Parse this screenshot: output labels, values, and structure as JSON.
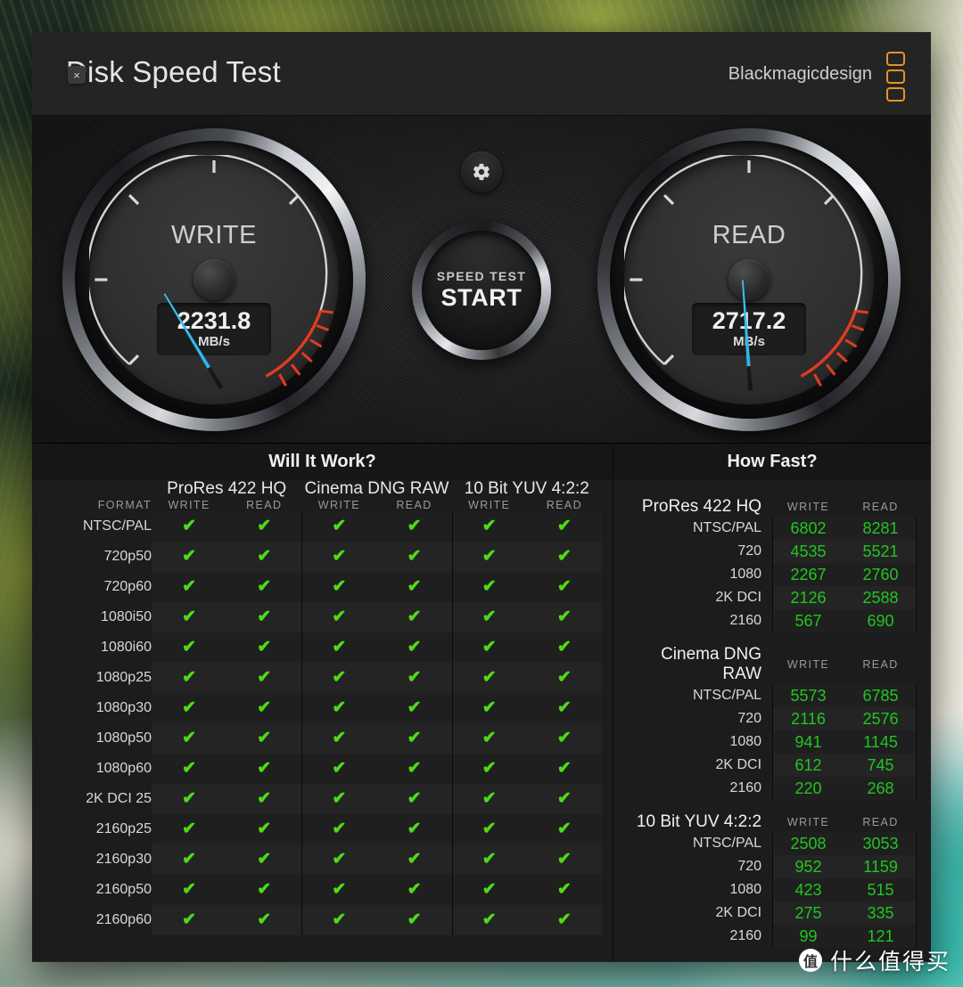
{
  "window": {
    "close_label": "×",
    "title": "Disk Speed Test",
    "brand": "Blackmagicdesign"
  },
  "gauges": {
    "write": {
      "label": "WRITE",
      "value": "2231.8",
      "unit": "MB/s",
      "needle_deg": -31
    },
    "read": {
      "label": "READ",
      "value": "2717.2",
      "unit": "MB/s",
      "needle_deg": -4
    }
  },
  "center": {
    "gear_icon": "gear-icon",
    "start_sub": "SPEED TEST",
    "start_main": "START"
  },
  "will_it_work": {
    "title": "Will It Work?",
    "format_header": "FORMAT",
    "groups": [
      "ProRes 422 HQ",
      "Cinema DNG RAW",
      "10 Bit YUV 4:2:2"
    ],
    "sub_headers": [
      "WRITE",
      "READ"
    ],
    "formats": [
      "NTSC/PAL",
      "720p50",
      "720p60",
      "1080i50",
      "1080i60",
      "1080p25",
      "1080p30",
      "1080p50",
      "1080p60",
      "2K DCI 25",
      "2160p25",
      "2160p30",
      "2160p50",
      "2160p60"
    ],
    "check_glyph": "✔",
    "check_color": "#4ddb19",
    "rows": [
      {
        "format": "NTSC/PAL",
        "cells": [
          true,
          true,
          true,
          true,
          true,
          true
        ]
      },
      {
        "format": "720p50",
        "cells": [
          true,
          true,
          true,
          true,
          true,
          true
        ]
      },
      {
        "format": "720p60",
        "cells": [
          true,
          true,
          true,
          true,
          true,
          true
        ]
      },
      {
        "format": "1080i50",
        "cells": [
          true,
          true,
          true,
          true,
          true,
          true
        ]
      },
      {
        "format": "1080i60",
        "cells": [
          true,
          true,
          true,
          true,
          true,
          true
        ]
      },
      {
        "format": "1080p25",
        "cells": [
          true,
          true,
          true,
          true,
          true,
          true
        ]
      },
      {
        "format": "1080p30",
        "cells": [
          true,
          true,
          true,
          true,
          true,
          true
        ]
      },
      {
        "format": "1080p50",
        "cells": [
          true,
          true,
          true,
          true,
          true,
          true
        ]
      },
      {
        "format": "1080p60",
        "cells": [
          true,
          true,
          true,
          true,
          true,
          true
        ]
      },
      {
        "format": "2K DCI 25",
        "cells": [
          true,
          true,
          true,
          true,
          true,
          true
        ]
      },
      {
        "format": "2160p25",
        "cells": [
          true,
          true,
          true,
          true,
          true,
          true
        ]
      },
      {
        "format": "2160p30",
        "cells": [
          true,
          true,
          true,
          true,
          true,
          true
        ]
      },
      {
        "format": "2160p50",
        "cells": [
          true,
          true,
          true,
          true,
          true,
          true
        ]
      },
      {
        "format": "2160p60",
        "cells": [
          true,
          true,
          true,
          true,
          true,
          true
        ]
      }
    ]
  },
  "how_fast": {
    "title": "How Fast?",
    "sub_headers": [
      "WRITE",
      "READ"
    ],
    "value_color": "#21c521",
    "groups": [
      {
        "name": "ProRes 422 HQ",
        "rows": [
          {
            "label": "NTSC/PAL",
            "write": "6802",
            "read": "8281"
          },
          {
            "label": "720",
            "write": "4535",
            "read": "5521"
          },
          {
            "label": "1080",
            "write": "2267",
            "read": "2760"
          },
          {
            "label": "2K DCI",
            "write": "2126",
            "read": "2588"
          },
          {
            "label": "2160",
            "write": "567",
            "read": "690"
          }
        ]
      },
      {
        "name": "Cinema DNG RAW",
        "rows": [
          {
            "label": "NTSC/PAL",
            "write": "5573",
            "read": "6785"
          },
          {
            "label": "720",
            "write": "2116",
            "read": "2576"
          },
          {
            "label": "1080",
            "write": "941",
            "read": "1145"
          },
          {
            "label": "2K DCI",
            "write": "612",
            "read": "745"
          },
          {
            "label": "2160",
            "write": "220",
            "read": "268"
          }
        ]
      },
      {
        "name": "10 Bit YUV 4:2:2",
        "rows": [
          {
            "label": "NTSC/PAL",
            "write": "2508",
            "read": "3053"
          },
          {
            "label": "720",
            "write": "952",
            "read": "1159"
          },
          {
            "label": "1080",
            "write": "423",
            "read": "515"
          },
          {
            "label": "2K DCI",
            "write": "275",
            "read": "335"
          },
          {
            "label": "2160",
            "write": "99",
            "read": "121"
          }
        ]
      }
    ]
  },
  "watermark": {
    "badge": "值",
    "text": "什么值得买"
  }
}
